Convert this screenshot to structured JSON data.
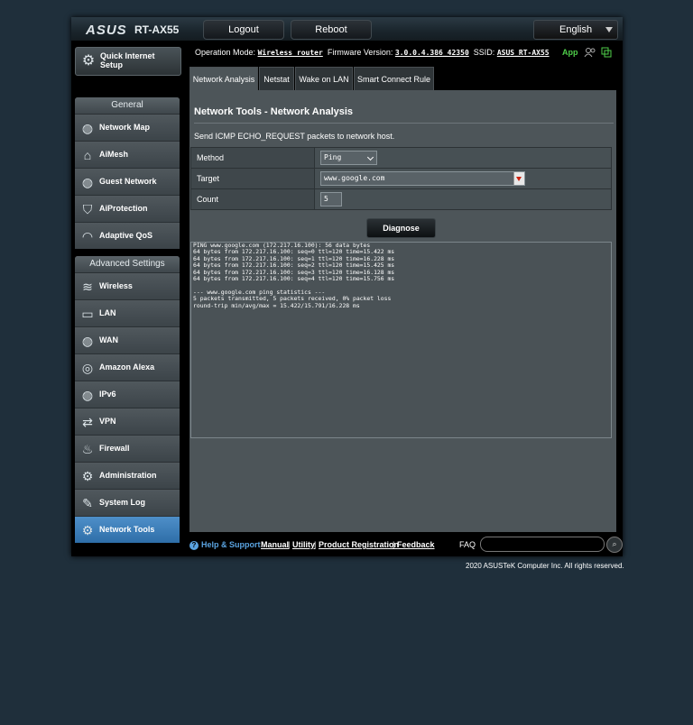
{
  "header": {
    "logo": "ASUS",
    "model": "RT-AX55",
    "logout_label": "Logout",
    "reboot_label": "Reboot",
    "language": "English"
  },
  "status": {
    "op_mode_label": "Operation Mode:",
    "op_mode_value": "Wireless router",
    "firmware_label": "Firmware Version:",
    "firmware_value": "3.0.0.4.386_42350",
    "ssid_label": "SSID:",
    "ssid_value": "ASUS_RT-AX55",
    "app_label": "App"
  },
  "sidebar": {
    "quick_setup": "Quick Internet Setup",
    "general_heading": "General",
    "general_items": [
      {
        "label": "Network Map",
        "icon": "globe-icon"
      },
      {
        "label": "AiMesh",
        "icon": "mesh-icon"
      },
      {
        "label": "Guest Network",
        "icon": "guest-globe-icon"
      },
      {
        "label": "AiProtection",
        "icon": "shield-icon"
      },
      {
        "label": "Adaptive QoS",
        "icon": "gauge-icon"
      }
    ],
    "advanced_heading": "Advanced Settings",
    "advanced_items": [
      {
        "label": "Wireless",
        "icon": "wifi-icon"
      },
      {
        "label": "LAN",
        "icon": "monitor-icon"
      },
      {
        "label": "WAN",
        "icon": "globe-icon"
      },
      {
        "label": "Amazon Alexa",
        "icon": "alexa-icon"
      },
      {
        "label": "IPv6",
        "icon": "ipv6-globe-icon"
      },
      {
        "label": "VPN",
        "icon": "vpn-icon"
      },
      {
        "label": "Firewall",
        "icon": "fire-icon"
      },
      {
        "label": "Administration",
        "icon": "gear-icon"
      },
      {
        "label": "System Log",
        "icon": "log-icon"
      },
      {
        "label": "Network Tools",
        "icon": "tools-icon"
      }
    ],
    "active": "Network Tools"
  },
  "tabs": [
    "Network Analysis",
    "Netstat",
    "Wake on LAN",
    "Smart Connect Rule"
  ],
  "active_tab": "Network Analysis",
  "panel": {
    "title": "Network Tools - Network Analysis",
    "description": "Send ICMP ECHO_REQUEST packets to network host.",
    "method_label": "Method",
    "method_value": "Ping",
    "target_label": "Target",
    "target_value": "www.google.com",
    "count_label": "Count",
    "count_value": "5",
    "diagnose_label": "Diagnose",
    "output": [
      "PING www.google.com (172.217.16.100): 56 data bytes",
      "64 bytes from 172.217.16.100: seq=0 ttl=120 time=15.422 ms",
      "64 bytes from 172.217.16.100: seq=1 ttl=120 time=16.228 ms",
      "64 bytes from 172.217.16.100: seq=2 ttl=120 time=15.425 ms",
      "64 bytes from 172.217.16.100: seq=3 ttl=120 time=16.128 ms",
      "64 bytes from 172.217.16.100: seq=4 ttl=120 time=15.756 ms",
      "",
      "--- www.google.com ping statistics ---",
      "5 packets transmitted, 5 packets received, 0% packet loss",
      "round-trip min/avg/max = 15.422/15.791/16.228 ms"
    ]
  },
  "footer": {
    "help_label": "Help & Support",
    "manual": "Manual",
    "utility": "Utility",
    "registration": "Product Registration",
    "feedback": "Feedback",
    "faq_label": "FAQ",
    "copyright": "2020 ASUSTeK Computer Inc. All rights reserved."
  }
}
